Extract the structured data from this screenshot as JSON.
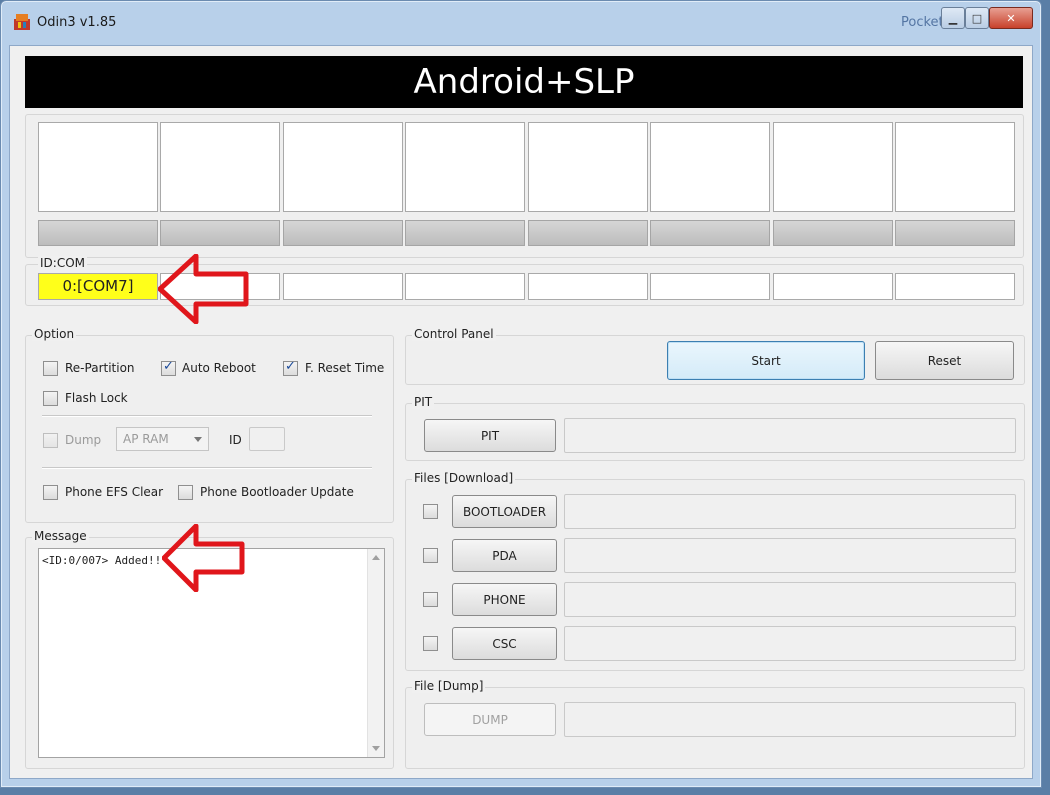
{
  "window": {
    "title": "Odin3 v1.85",
    "watermark": "Pocket-C"
  },
  "banner": {
    "title": "Android+SLP"
  },
  "id_com": {
    "label": "ID:COM",
    "slots": [
      "0:[COM7]",
      "",
      "",
      "",
      "",
      "",
      "",
      ""
    ]
  },
  "option": {
    "label": "Option",
    "re_partition": "Re-Partition",
    "auto_reboot": "Auto Reboot",
    "f_reset_time": "F. Reset Time",
    "flash_lock": "Flash Lock",
    "dump": "Dump",
    "dump_select": "AP RAM",
    "id_label": "ID",
    "phone_efs_clear": "Phone EFS Clear",
    "phone_bootloader_update": "Phone Bootloader Update"
  },
  "message": {
    "label": "Message",
    "text": "<ID:0/007> Added!!"
  },
  "control_panel": {
    "label": "Control Panel",
    "start": "Start",
    "reset": "Reset"
  },
  "pit": {
    "label": "PIT",
    "button": "PIT"
  },
  "files": {
    "label": "Files [Download]",
    "bootloader": "BOOTLOADER",
    "pda": "PDA",
    "phone": "PHONE",
    "csc": "CSC"
  },
  "file_dump": {
    "label": "File [Dump]",
    "button": "DUMP"
  },
  "colors": {
    "active_com": "#ffff1a",
    "annotation_arrow": "#e0161b"
  }
}
